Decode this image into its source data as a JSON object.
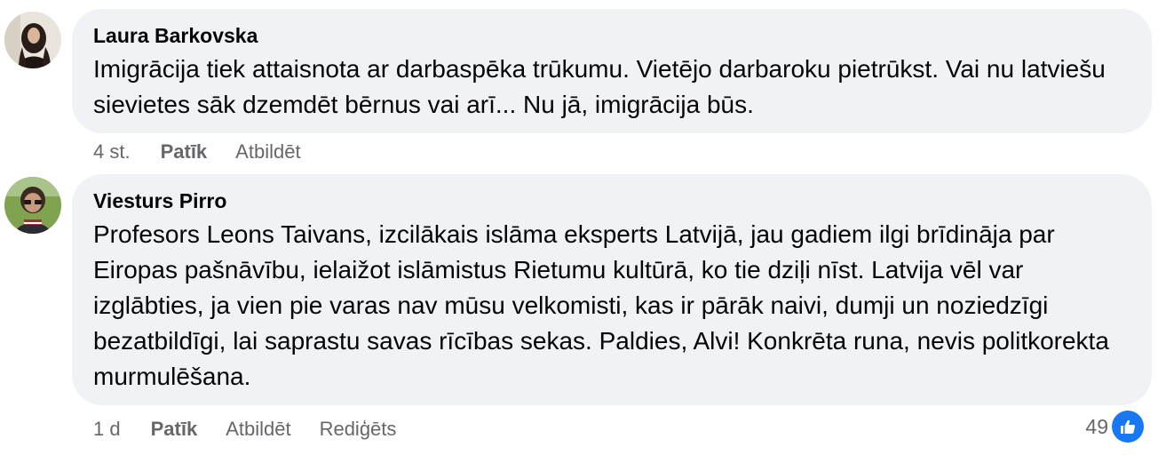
{
  "comments": [
    {
      "author": "Laura Barkovska",
      "text": "Imigrācija tiek attaisnota ar darbaspēka trūkumu. Vietējo darbaroku pietrūkst. Vai nu latviešu sievietes sāk dzemdēt bērnus vai arī... Nu jā, imigrācija būs.",
      "time": "4 st.",
      "like_label": "Patīk",
      "reply_label": "Atbildēt"
    },
    {
      "author": "Viesturs Pirro",
      "text": "Profesors Leons Taivans, izcilākais islāma eksperts Latvijā, jau gadiem ilgi brīdināja par Eiropas pašnāvību, ielaižot islāmistus Rietumu kultūrā, ko tie dziļi nīst. Latvija vēl var izglābties, ja vien pie varas nav mūsu velkomisti, kas ir pārāk naivi, dumji un noziedzīgi bezatbildīgi, lai saprastu savas rīcības sekas. Paldies, Alvi! Konkrēta runa, nevis politkorekta murmulēšana.",
      "time": "1 d",
      "like_label": "Patīk",
      "reply_label": "Atbildēt",
      "edited_label": "Rediģēts",
      "reaction_count": "49",
      "reaction_icon": "thumbs-up-icon"
    }
  ],
  "colors": {
    "bubble": "#f0f2f5",
    "secondary_text": "#65676b",
    "like_blue": "#1877f2"
  }
}
